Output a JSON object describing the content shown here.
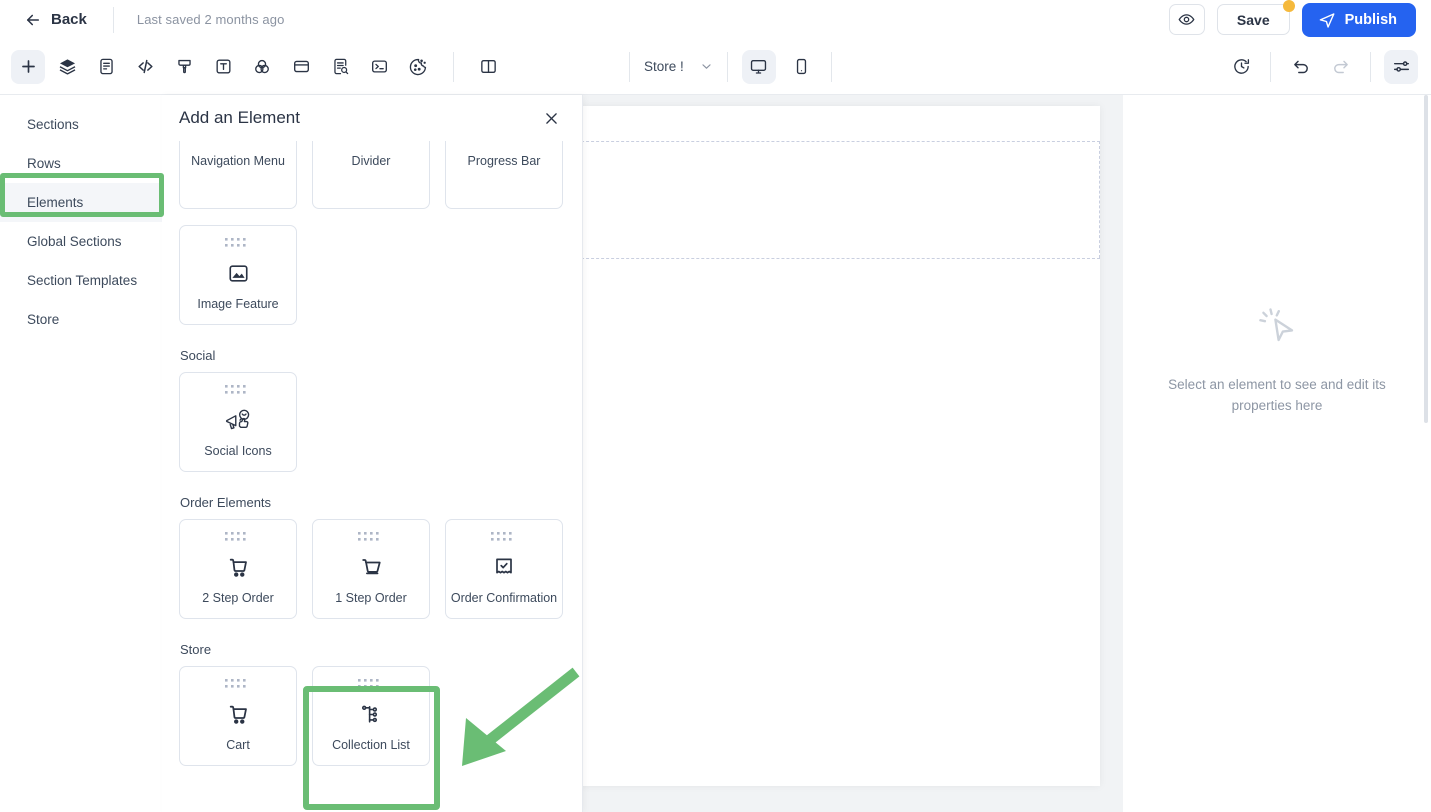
{
  "topbar": {
    "back_label": "Back",
    "back_icon": "arrow-left-icon",
    "last_saved": "Last saved 2 months ago",
    "preview_icon": "eye-icon",
    "save_label": "Save",
    "save_badge_color": "#f5b93c",
    "publish_label": "Publish",
    "publish_icon": "send-icon",
    "publish_color": "#2563f0"
  },
  "toolbar": {
    "tools": [
      {
        "name": "add-element-tool",
        "icon": "plus-icon",
        "active": true
      },
      {
        "name": "layers-tool",
        "icon": "layers-icon",
        "active": false
      },
      {
        "name": "pages-tool",
        "icon": "document-icon",
        "active": false
      },
      {
        "name": "code-tool",
        "icon": "code-icon",
        "active": false
      },
      {
        "name": "theme-tool",
        "icon": "paint-brush-icon",
        "active": false
      },
      {
        "name": "typography-tool",
        "icon": "text-box-icon",
        "active": false
      },
      {
        "name": "colors-tool",
        "icon": "color-circles-icon",
        "active": false
      },
      {
        "name": "popup-tool",
        "icon": "card-icon",
        "active": false
      },
      {
        "name": "seo-tool",
        "icon": "document-search-icon",
        "active": false
      },
      {
        "name": "script-tool",
        "icon": "terminal-icon",
        "active": false
      },
      {
        "name": "cookie-tool",
        "icon": "cookie-icon",
        "active": false
      },
      {
        "name": "split-panel-tool",
        "icon": "split-panel-icon",
        "active": false
      }
    ],
    "store_label": "Store !",
    "store_chevron_icon": "chevron-down-icon",
    "devices": [
      {
        "name": "desktop-view-button",
        "icon": "desktop-icon",
        "active": true
      },
      {
        "name": "mobile-view-button",
        "icon": "mobile-icon",
        "active": false
      }
    ],
    "right_tools": [
      {
        "name": "version-history-button",
        "icon": "history-clock-icon",
        "active": false
      },
      {
        "name": "undo-button",
        "icon": "undo-icon",
        "active": false
      },
      {
        "name": "redo-button",
        "icon": "redo-icon",
        "active": false
      },
      {
        "name": "settings-button",
        "icon": "sliders-icon",
        "active": true
      }
    ]
  },
  "sidebar": {
    "items": [
      {
        "label": "Sections",
        "selected": false
      },
      {
        "label": "Rows",
        "selected": false
      },
      {
        "label": "Elements",
        "selected": true
      },
      {
        "label": "Global Sections",
        "selected": false
      },
      {
        "label": "Section Templates",
        "selected": false
      },
      {
        "label": "Store",
        "selected": false
      }
    ],
    "highlight_color": "#6abd74"
  },
  "panel": {
    "title": "Add an Element",
    "close_icon": "close-icon",
    "clipped_row": [
      {
        "label": "Navigation Menu",
        "icon": "menu-icon"
      },
      {
        "label": "Divider",
        "icon": "divider-icon"
      },
      {
        "label": "Progress Bar",
        "icon": "progress-bar-icon"
      }
    ],
    "clipped_row2": [
      {
        "label": "Image Feature",
        "icon": "image-icon"
      }
    ],
    "groups": [
      {
        "title": "Social",
        "items": [
          {
            "label": "Social Icons",
            "icon": "megaphone-social-icon"
          }
        ]
      },
      {
        "title": "Order Elements",
        "items": [
          {
            "label": "2 Step Order",
            "icon": "cart-wheels-icon"
          },
          {
            "label": "1 Step Order",
            "icon": "basket-icon"
          },
          {
            "label": "Order Confirmation",
            "icon": "receipt-check-icon"
          }
        ]
      },
      {
        "title": "Store",
        "items": [
          {
            "label": "Cart",
            "icon": "cart-wheels-icon"
          },
          {
            "label": "Collection List",
            "icon": "hierarchy-tree-icon",
            "highlighted": true
          }
        ]
      }
    ],
    "highlight_color": "#6abd74",
    "arrow_color": "#6abd74"
  },
  "properties_panel": {
    "empty_icon": "cursor-click-icon",
    "empty_text": "Select an element to see and edit its properties here"
  }
}
